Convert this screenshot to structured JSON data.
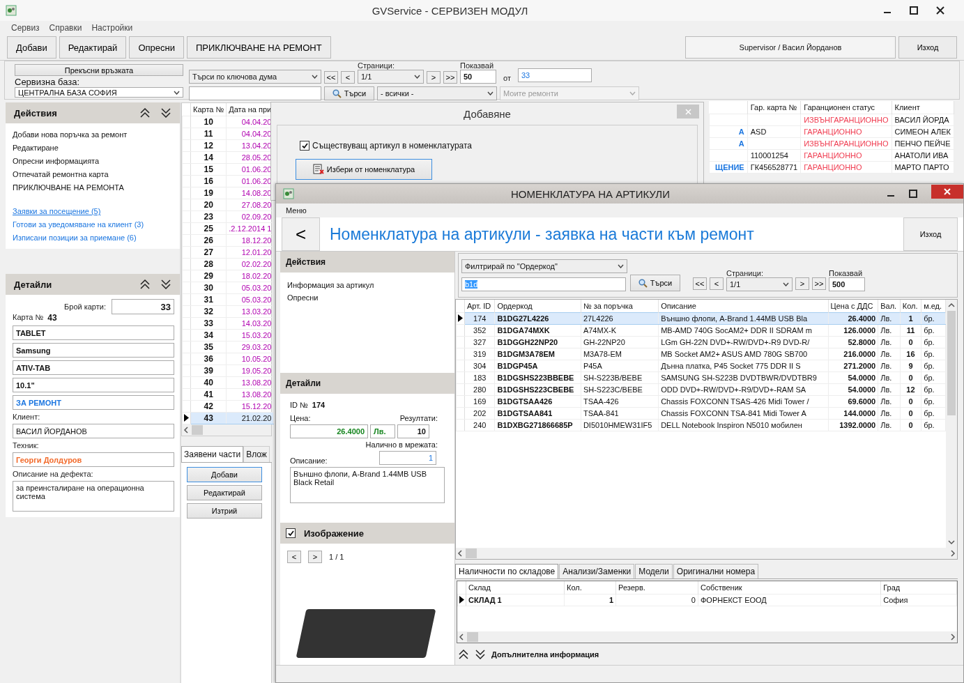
{
  "main_window": {
    "title": "GVService - СЕРВИЗЕН МОДУЛ"
  },
  "menu": [
    "Сервиз",
    "Справки",
    "Настройки"
  ],
  "toolbar": {
    "buttons": [
      "Добави",
      "Редактирай",
      "Опресни",
      "ПРИКЛЮЧВАНЕ НА РЕМОНТ"
    ],
    "user": "Supervisor / Васил Йорданов",
    "exit": "Изход"
  },
  "filters": {
    "disconnect": "Прекъсни връзката",
    "base_label": "Сервизна база:",
    "base": "ЦЕНТРАЛНА БАЗА СОФИЯ",
    "search_mode": "Търси по ключова дума",
    "nav_back": [
      "<<",
      "<"
    ],
    "nav_fwd": [
      ">",
      ">>"
    ],
    "pages_label": "Страници:",
    "page": "1/1",
    "show_label": "Показвай",
    "show": "50",
    "of_label": "от",
    "of": "33",
    "search_button": "Търси",
    "status": "- всички -",
    "mine": {
      "label": "Моите ремонти",
      "disabled": true
    }
  },
  "actions": {
    "title": "Действия",
    "items": [
      "Добави нова поръчка за ремонт",
      "Редактиране",
      "Опресни информацията",
      "Отпечатай ремонтна карта",
      "ПРИКЛЮЧВАНЕ НА РЕМОНТА"
    ],
    "links": [
      {
        "label": "Заявки за посещение (5)",
        "hovered": true
      },
      {
        "label": "Готови за уведомяване на клиент (3)",
        "hovered": false
      },
      {
        "label": "Изписани позиции за приемане (6)",
        "hovered": false
      }
    ]
  },
  "details": {
    "title": "Детайли",
    "count_label": "Брой карти:",
    "count": "33",
    "card_label": "Карта №",
    "card": "43",
    "fields": [
      {
        "value": "TABLET",
        "kind": "plain"
      },
      {
        "value": "Samsung",
        "kind": "plain"
      },
      {
        "value": "ATIV-TAB",
        "kind": "plain"
      },
      {
        "value": "10.1\"",
        "kind": "plain"
      },
      {
        "value": "ЗА РЕМОНТ",
        "kind": "status"
      }
    ],
    "client_label": "Клиент:",
    "client": "ВАСИЛ ЙОРДАНОВ",
    "tech_label": "Техник:",
    "tech": "Георги Долдуров",
    "defect_label": "Описание на дефекта:",
    "defect": "за преинсталиране на операционна система"
  },
  "cards": {
    "columns": [
      "Карта №",
      "Дата на при"
    ],
    "rows": [
      {
        "no": "10",
        "date": "04.04.20",
        "selected": false
      },
      {
        "no": "11",
        "date": "04.04.20",
        "selected": false
      },
      {
        "no": "12",
        "date": "13.04.20",
        "selected": false
      },
      {
        "no": "14",
        "date": "28.05.20",
        "selected": false
      },
      {
        "no": "15",
        "date": "01.06.20",
        "selected": false
      },
      {
        "no": "16",
        "date": "01.06.20",
        "selected": false
      },
      {
        "no": "19",
        "date": "14.08.20",
        "selected": false
      },
      {
        "no": "20",
        "date": "27.08.20",
        "selected": false
      },
      {
        "no": "23",
        "date": "02.09.20",
        "selected": false
      },
      {
        "no": "25",
        "date": ".2.12.2014 1",
        "selected": false
      },
      {
        "no": "26",
        "date": "18.12.20",
        "selected": false
      },
      {
        "no": "27",
        "date": "12.01.20",
        "selected": false
      },
      {
        "no": "28",
        "date": "02.02.20",
        "selected": false
      },
      {
        "no": "29",
        "date": "18.02.20",
        "selected": false
      },
      {
        "no": "30",
        "date": "05.03.20",
        "selected": false
      },
      {
        "no": "31",
        "date": "05.03.20",
        "selected": false
      },
      {
        "no": "32",
        "date": "13.03.20",
        "selected": false
      },
      {
        "no": "33",
        "date": "14.03.20",
        "selected": false
      },
      {
        "no": "34",
        "date": "15.03.20",
        "selected": false
      },
      {
        "no": "35",
        "date": "29.03.20",
        "selected": false
      },
      {
        "no": "36",
        "date": "10.05.20",
        "selected": false
      },
      {
        "no": "39",
        "date": "19.05.20",
        "selected": false
      },
      {
        "no": "40",
        "date": "13.08.20",
        "selected": false
      },
      {
        "no": "41",
        "date": "13.08.20",
        "selected": false
      },
      {
        "no": "42",
        "date": "15.12.20",
        "selected": false
      },
      {
        "no": "43",
        "date": "21.02.20",
        "selected": true
      }
    ]
  },
  "parts_tabs": [
    {
      "label": "Заявени части",
      "selected": true
    },
    {
      "label": "Влож",
      "selected": false
    }
  ],
  "parts_buttons": [
    "Добави",
    "Редактирай",
    "Изтрий"
  ],
  "repairs": {
    "columns": [
      "Гар. карта №",
      "Гаранционен статус",
      "Клиент"
    ],
    "rows": [
      {
        "status": "ИЗВЪНГАРАНЦИОННО",
        "client": "ВАСИЛ ЙОРДА"
      },
      {
        "column_1": "А",
        "card": "ASD",
        "status": "ГАРАНЦИОННО",
        "client": "СИМЕОН АЛЕК"
      },
      {
        "column_1": "А",
        "status": "ИЗВЪНГАРАНЦИОННО",
        "client": "ПЕНЧО ПЕЙЧЕ"
      },
      {
        "card": "110001254",
        "status": "ГАРАНЦИОННО",
        "client": "АНАТОЛИ ИВА"
      },
      {
        "column_1": "ЩЕНИЕ",
        "card": "ГК456528771",
        "status": "ГАРАНЦИОННО",
        "client": "МАРТО ПАРТО"
      }
    ]
  },
  "add_dialog": {
    "title": "Добавяне",
    "existing": {
      "label": "Съществуващ артикул в номенклатурата",
      "checked": true
    },
    "pick_button": "Избери от номенклатура"
  },
  "nomenclature": {
    "title": "НОМЕНКЛАТУРА НА АРТИКУЛИ",
    "menu": "Меню",
    "back": "<",
    "heading": "Номенклатура на артикули - заявка на части към ремонт",
    "exit": "Изход",
    "actions": {
      "title": "Действия",
      "items": [
        "Информация за артикул",
        "Опресни"
      ]
    },
    "details": {
      "title": "Детайли",
      "id_label": "ID №",
      "id": "174",
      "price_label": "Цена:",
      "price": "26.4000",
      "currency": "Лв.",
      "results_label": "Резултати:",
      "results": "10",
      "network_label": "Налично в мрежата:",
      "network": "1",
      "desc_label": "Описание:",
      "desc": "Външно флопи, A-Brand 1.44MB USB Black Retail"
    },
    "image": {
      "label": "Изображение",
      "checked": true,
      "prev": "<",
      "next": ">",
      "counter": "1 / 1"
    },
    "filter": {
      "mode": "Филтрирай по \"Ордеркод\"",
      "query": "b1d",
      "search_button": "Търси",
      "nav_back": [
        "<<",
        "<"
      ],
      "nav_fwd": [
        ">",
        ">>"
      ],
      "pages_label": "Страници:",
      "page": "1/1",
      "show_label": "Показвай",
      "show": "500"
    },
    "table": {
      "columns": [
        "Арт. ID",
        "Ордеркод",
        "№ за поръчка",
        "Описание",
        "Цена с ДДС",
        "Вал.",
        "Кол.",
        "м.ед."
      ],
      "rows": [
        {
          "id": "174",
          "code": "B1DG27L4226",
          "order": "27L4226",
          "desc": "Външно флопи, A-Brand 1.44MB USB Bla",
          "price": "26.4000",
          "cur": "Лв.",
          "qty": "1",
          "unit": "бр.",
          "selected": true
        },
        {
          "id": "352",
          "code": "B1DGA74MXK",
          "order": "A74MX-K",
          "desc": "MB-AMD 740G SocAM2+ DDR II SDRAM m",
          "price": "126.0000",
          "cur": "Лв.",
          "qty": "11",
          "unit": "бр.",
          "selected": false
        },
        {
          "id": "327",
          "code": "B1DGGH22NP20",
          "order": "GH-22NP20",
          "desc": "LGm GH-22N DVD+-RW/DVD+-R9 DVD-R/",
          "price": "52.8000",
          "cur": "Лв.",
          "qty": "0",
          "unit": "бр.",
          "selected": false
        },
        {
          "id": "319",
          "code": "B1DGM3A78EM",
          "order": "M3A78-EM",
          "desc": "MB Socket AM2+ ASUS AMD 780G SB700",
          "price": "216.0000",
          "cur": "Лв.",
          "qty": "16",
          "unit": "бр.",
          "selected": false
        },
        {
          "id": "304",
          "code": "B1DGP45A",
          "order": "P45A",
          "desc": "Дънна платка, P45 Socket 775 DDR II S",
          "price": "271.2000",
          "cur": "Лв.",
          "qty": "9",
          "unit": "бр.",
          "selected": false
        },
        {
          "id": "183",
          "code": "B1DGSHS223BBEBE",
          "order": "SH-S223B/BEBE",
          "desc": "SAMSUNG SH-S223B DVDTBWR/DVDTBR9",
          "price": "54.0000",
          "cur": "Лв.",
          "qty": "0",
          "unit": "бр.",
          "selected": false
        },
        {
          "id": "280",
          "code": "B1DGSHS223CBEBE",
          "order": "SH-S223C/BEBE",
          "desc": "ODD DVD+-RW/DVD+-R9/DVD+-RAM SA",
          "price": "54.0000",
          "cur": "Лв.",
          "qty": "12",
          "unit": "бр.",
          "selected": false
        },
        {
          "id": "169",
          "code": "B1DGTSAA426",
          "order": "TSAA-426",
          "desc": "Chassis FOXCONN TSAS-426 Midi Tower /",
          "price": "69.6000",
          "cur": "Лв.",
          "qty": "0",
          "unit": "бр.",
          "selected": false
        },
        {
          "id": "202",
          "code": "B1DGTSAA841",
          "order": "TSAA-841",
          "desc": "Chassis FOXCONN TSA-841 Midi Tower A",
          "price": "144.0000",
          "cur": "Лв.",
          "qty": "0",
          "unit": "бр.",
          "selected": false
        },
        {
          "id": "240",
          "code": "B1DXBG271866685P",
          "order": "DI5010HMEW31IF5",
          "desc": "DELL Notebook Inspiron N5010 мобилен",
          "price": "1392.0000",
          "cur": "Лв.",
          "qty": "0",
          "unit": "бр.",
          "selected": false
        }
      ]
    },
    "tabs": [
      {
        "label": "Наличности по складове",
        "selected": true
      },
      {
        "label": "Анализи/Заменки",
        "selected": false
      },
      {
        "label": "Модели",
        "selected": false
      },
      {
        "label": "Оригинални номера",
        "selected": false
      }
    ],
    "stock": {
      "columns": [
        "Склад",
        "Кол.",
        "Резерв.",
        "Собственик",
        "Град"
      ],
      "rows": [
        {
          "store": "СКЛАД 1",
          "qty": "1",
          "reserved": "0",
          "owner": "ФОРНЕКСТ ЕООД",
          "city": "София",
          "selected": true
        }
      ]
    },
    "footer": "Допълнителна информация"
  }
}
